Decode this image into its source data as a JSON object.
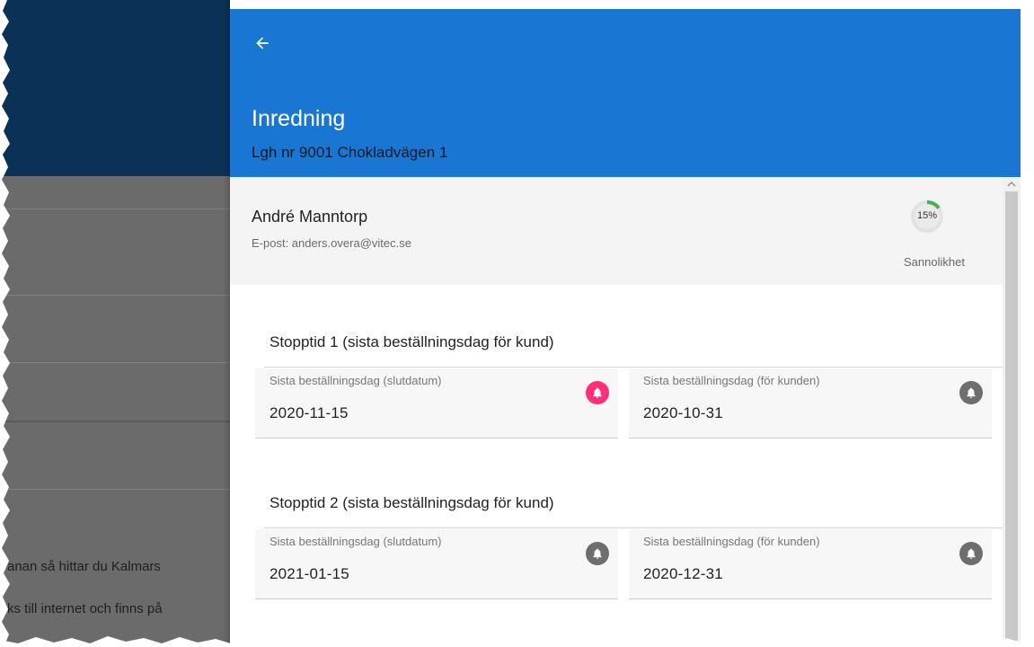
{
  "background": {
    "text_line_1": "anan så hittar du Kalmars",
    "text_line_2": "ks till internet och finns på"
  },
  "panel": {
    "header": {
      "back_icon": "arrow-left-icon",
      "title": "Inredning",
      "subtitle": "Lgh nr 9001 Chokladvägen 1",
      "color": "#1976d2"
    },
    "customer": {
      "name": "André Manntorp",
      "email": "E-post: anders.overa@vitec.se",
      "probability": {
        "value": "15%",
        "fraction": 0.15,
        "label": "Sannolikhet",
        "color": "#4caf50"
      }
    },
    "sections": [
      {
        "title": "Stopptid 1 (sista beställningsdag för kund)",
        "fields": [
          {
            "label": "Sista beställningsdag (slutdatum)",
            "value": "2020-11-15",
            "bell_icon": "bell-icon",
            "bell_active": true
          },
          {
            "label": "Sista beställningsdag (för kunden)",
            "value": "2020-10-31",
            "bell_icon": "bell-icon",
            "bell_active": false
          }
        ]
      },
      {
        "title": "Stopptid 2 (sista beställningsdag för kund)",
        "fields": [
          {
            "label": "Sista beställningsdag (slutdatum)",
            "value": "2021-01-15",
            "bell_icon": "bell-icon",
            "bell_active": false
          },
          {
            "label": "Sista beställningsdag (för kunden)",
            "value": "2020-12-31",
            "bell_icon": "bell-icon",
            "bell_active": false
          }
        ]
      }
    ],
    "colors": {
      "bell_active": "#ff2f7a",
      "bell_inactive": "#6e6e6e"
    }
  }
}
